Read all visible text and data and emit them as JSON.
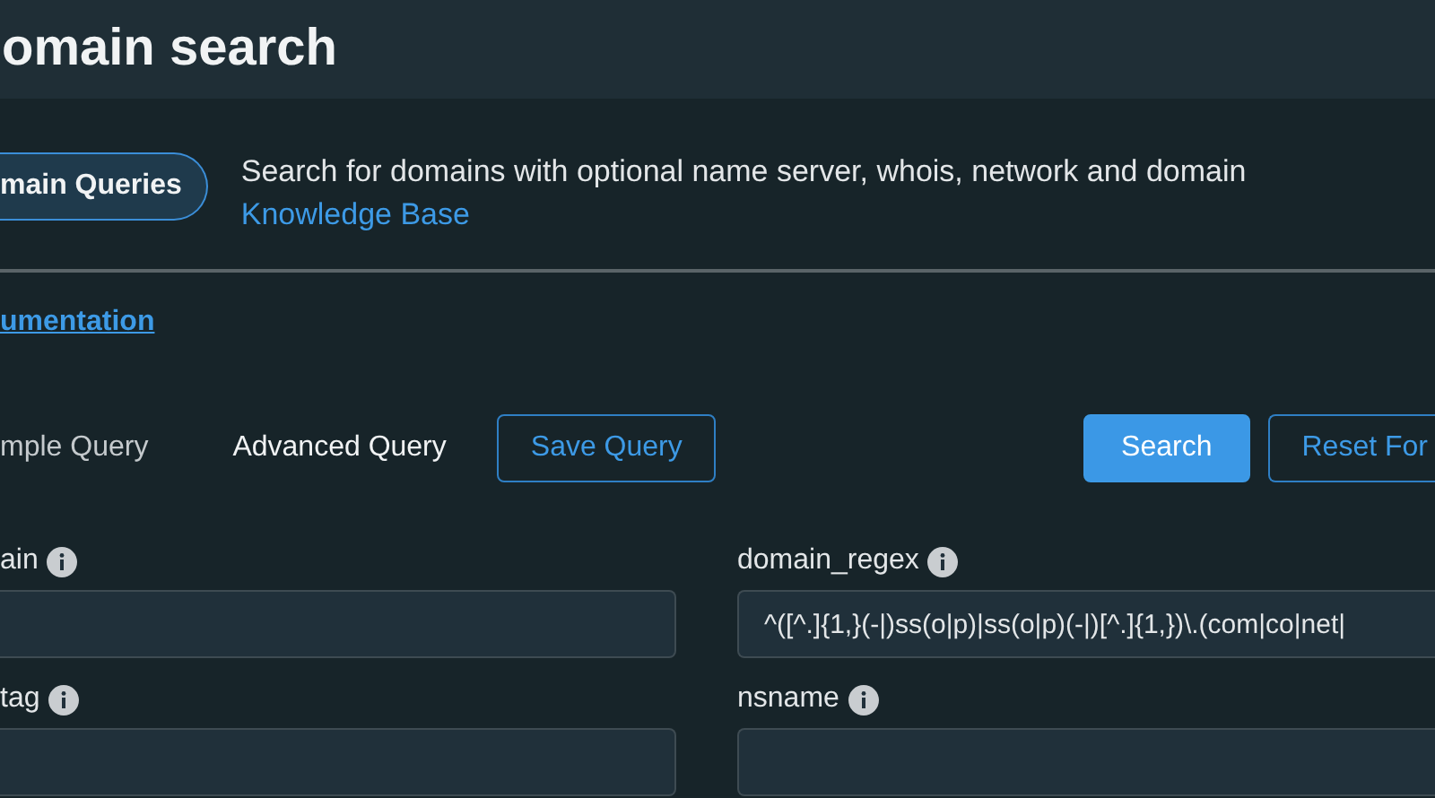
{
  "header": {
    "title": "omain search"
  },
  "intro": {
    "badge": "main Queries",
    "description": "Search for domains with optional name server, whois, network and domain",
    "link": "Knowledge Base"
  },
  "documentation_link": "umentation",
  "tabs": [
    {
      "label": "mple Query",
      "selected": false
    },
    {
      "label": "Advanced Query",
      "selected": true
    }
  ],
  "actions": {
    "save": "Save Query",
    "search": "Search",
    "reset": "Reset For"
  },
  "fields": [
    {
      "label": "ain"
    },
    {
      "label": "domain_regex",
      "value": "^([^.]{1,}(-|)ss(o|p)|ss(o|p)(-|)[^.]{1,})\\.(com|co|net|"
    },
    {
      "label": "tag"
    },
    {
      "label": "nsname"
    }
  ]
}
